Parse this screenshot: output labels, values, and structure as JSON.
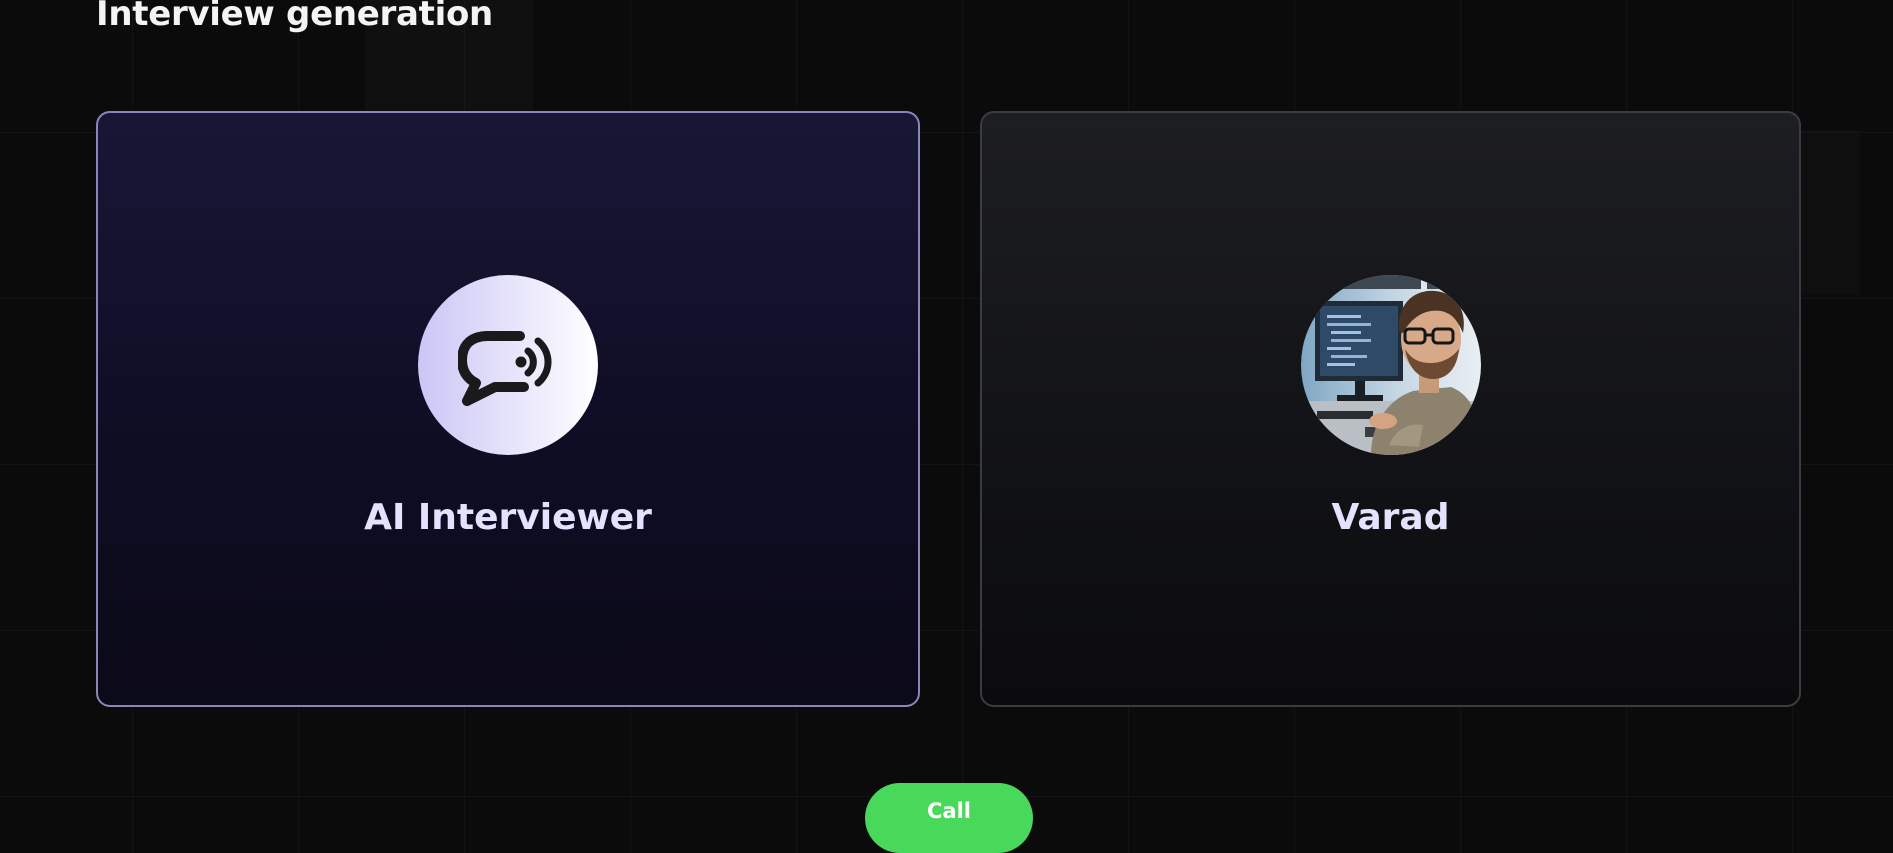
{
  "header": {
    "title": "Interview generation"
  },
  "cards": {
    "ai": {
      "name": "AI Interviewer",
      "icon": "chat-bubble-sound-icon"
    },
    "user": {
      "name": "Varad",
      "avatar": "user-avatar-photo"
    }
  },
  "actions": {
    "call_label": "Call"
  },
  "colors": {
    "call_button": "#48d95a",
    "ai_card_border": "#8a87b8",
    "user_card_border": "#3b3c40",
    "background": "#0b0b0c",
    "name_text": "#e4e3ff"
  }
}
